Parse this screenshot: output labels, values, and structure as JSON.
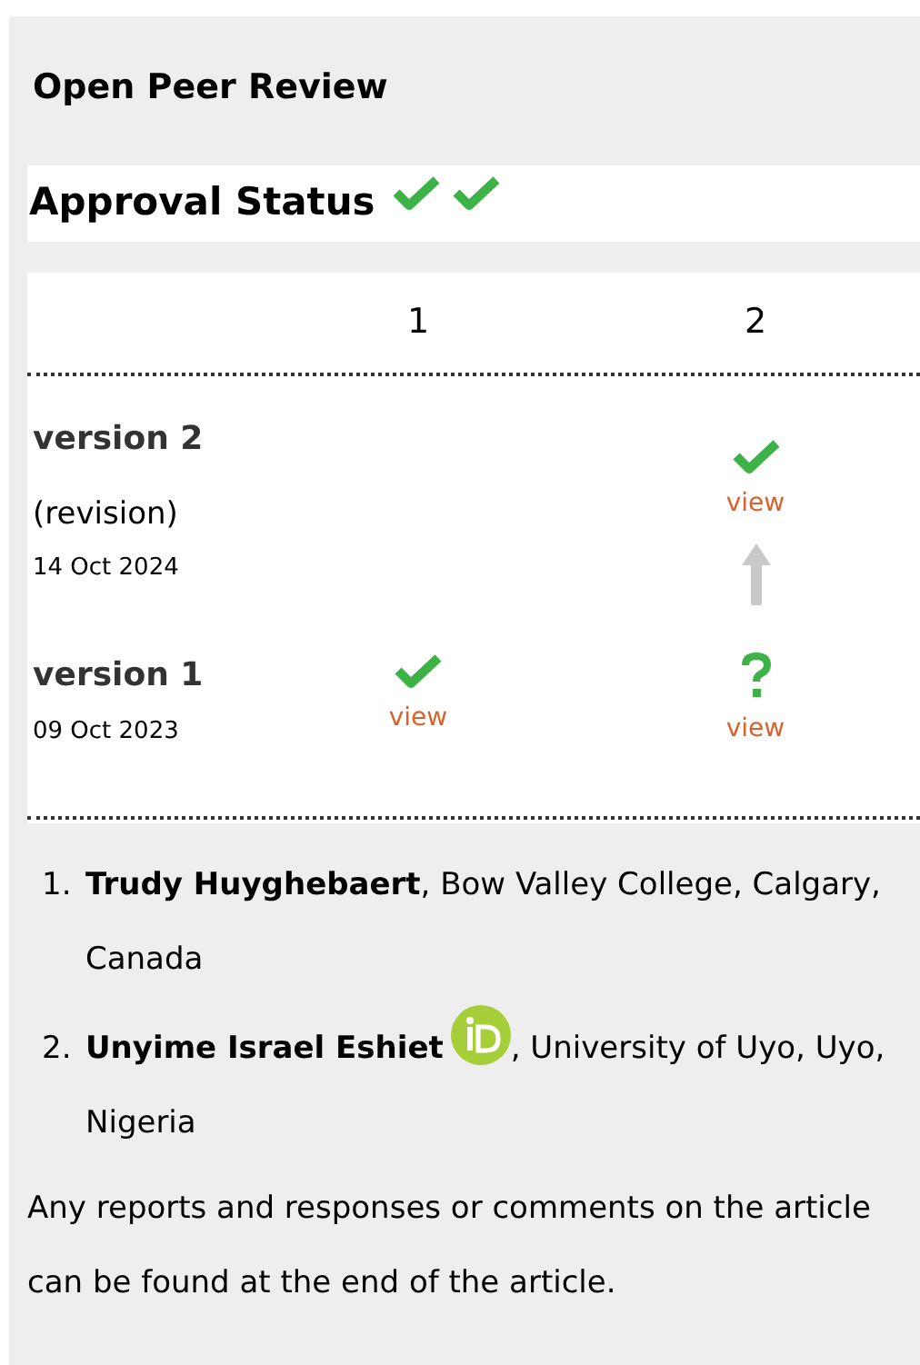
{
  "title": "Open Peer Review",
  "approval": {
    "label": "Approval Status",
    "marks": [
      {
        "kind": "approved"
      },
      {
        "kind": "approved"
      }
    ]
  },
  "table": {
    "columns": [
      "1",
      "2"
    ],
    "versions": [
      {
        "name": "version 2",
        "note": "(revision)",
        "date": "14 Oct 2024",
        "report_2": {
          "kind": "approved",
          "link": "view",
          "arrow_below": true
        }
      },
      {
        "name": "version 1",
        "date": "09 Oct 2023",
        "report_1": {
          "kind": "approved",
          "link": "view",
          "arrow_below": false
        },
        "report_2": {
          "kind": "questioned",
          "link": "view",
          "arrow_below": false
        }
      }
    ]
  },
  "reviewers": [
    {
      "number": "1.",
      "name": "Trudy Huyghebaert",
      "orcid": false,
      "affiliation": ", Bow Valley College, Calgary, Canada"
    },
    {
      "number": "2.",
      "name": "Unyime Israel Eshiet",
      "orcid": true,
      "affiliation": ", University of Uyo, Uyo, Nigeria"
    }
  ],
  "footnote": "Any reports and responses or comments on the article can be found at the end of the article."
}
